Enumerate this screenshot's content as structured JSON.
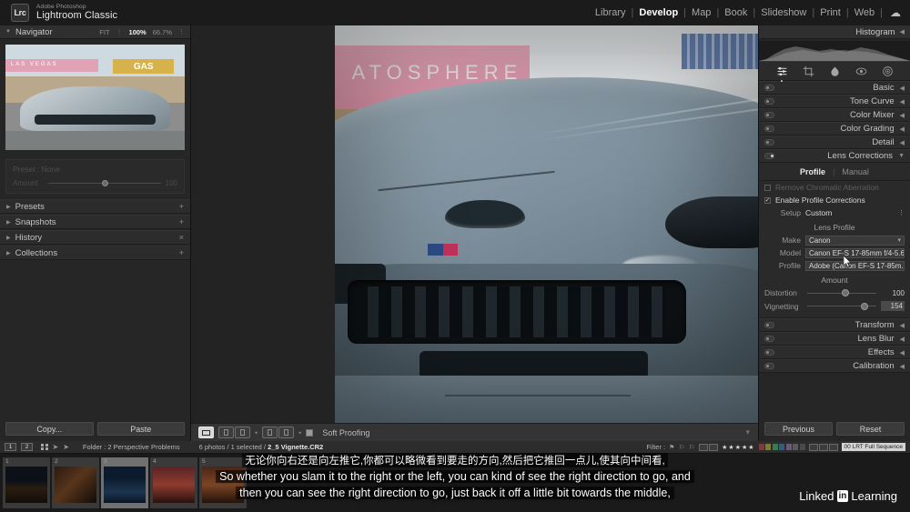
{
  "app": {
    "badge": "Lrc",
    "brand_sup": "Adobe Photoshop",
    "brand_main": "Lightroom Classic"
  },
  "modules": {
    "items": [
      {
        "label": "Library",
        "active": false
      },
      {
        "label": "Develop",
        "active": true
      },
      {
        "label": "Map",
        "active": false
      },
      {
        "label": "Book",
        "active": false
      },
      {
        "label": "Slideshow",
        "active": false
      },
      {
        "label": "Print",
        "active": false
      },
      {
        "label": "Web",
        "active": false
      }
    ],
    "separator": "|",
    "cloud_icon": "cloud-icon"
  },
  "left_panel": {
    "navigator": {
      "title": "Navigator",
      "zoom_fit": "FIT",
      "zoom_100": "100%",
      "zoom_667": "66.7%"
    },
    "preset_strip": {
      "preset_label": "Preset : None",
      "amount_label": "Amount",
      "amount_value": "100"
    },
    "sections": [
      {
        "label": "Presets",
        "adorn": "+"
      },
      {
        "label": "Snapshots",
        "adorn": "+"
      },
      {
        "label": "History",
        "adorn": "×"
      },
      {
        "label": "Collections",
        "adorn": "+"
      }
    ],
    "copy_label": "Copy...",
    "paste_label": "Paste"
  },
  "photo": {
    "wall_text": "ATOSPHERE"
  },
  "center_toolbar": {
    "soft_proofing_label": "Soft Proofing",
    "dot": "•"
  },
  "right_panel": {
    "histogram_title": "Histogram",
    "tools": [
      "basic-adjust-icon",
      "crop-icon",
      "heal-icon",
      "masking-icon",
      "radial-icon"
    ],
    "sections": [
      {
        "label": "Basic",
        "expanded": false
      },
      {
        "label": "Tone Curve",
        "expanded": false
      },
      {
        "label": "Color Mixer",
        "expanded": false
      },
      {
        "label": "Color Grading",
        "expanded": false
      },
      {
        "label": "Detail",
        "expanded": false
      },
      {
        "label": "Lens Corrections",
        "expanded": true
      }
    ],
    "lens_corrections": {
      "tab_profile": "Profile",
      "tab_manual": "Manual",
      "remove_ca_label": "Remove Chromatic Aberration",
      "remove_ca_checked": false,
      "enable_profile_label": "Enable Profile Corrections",
      "enable_profile_checked": true,
      "check_glyph": "✓",
      "setup_key": "Setup",
      "setup_value": "Custom",
      "lens_profile_label": "Lens Profile",
      "make_key": "Make",
      "make_value": "Canon",
      "model_key": "Model",
      "model_value": "Canon EF-S 17-85mm f/4-5.6...",
      "profile_key": "Profile",
      "profile_value": "Adobe (Canon EF-S 17-85m...",
      "amount_label": "Amount",
      "distortion_key": "Distortion",
      "distortion_value": "100",
      "vignetting_key": "Vignetting",
      "vignetting_value": "154"
    },
    "sections_lower": [
      {
        "label": "Transform"
      },
      {
        "label": "Lens Blur"
      },
      {
        "label": "Effects"
      },
      {
        "label": "Calibration"
      }
    ],
    "previous_label": "Previous",
    "reset_label": "Reset"
  },
  "filmstrip": {
    "page_left": "1",
    "page_right": "2",
    "folder_label": "Folder : 2 Perspective Problems",
    "photo_count": "6 photos / 1 selected / ",
    "selected_file": "2_5 Vignette.CR2",
    "filter_label": "Filter :",
    "stars": "★★★★★",
    "sequence_label": "00 LRT Full Sequence",
    "color_swatches": [
      "#7a3b3b",
      "#7a7a3b",
      "#3b7a4a",
      "#3b5a7a",
      "#6a5a7a",
      "#5a5a5a",
      "#4a4a4a"
    ],
    "thumbnails": [
      {
        "number": "1",
        "name": "night-cityscape"
      },
      {
        "number": "2",
        "name": "night-street"
      },
      {
        "number": "3",
        "name": "big-ben-tower"
      },
      {
        "number": "4",
        "name": "red-interior"
      },
      {
        "number": "5",
        "name": "warm-interior"
      }
    ]
  },
  "subtitles": {
    "chinese": "无论你向右还是向左推它,你都可以略微看到要走的方向,然后把它推回一点儿,使其向中间看,",
    "english_line1": "So whether you slam it to the right or the left, you can kind of see the right direction to go, and",
    "english_line2": "then you can see the right direction to go, just back it off a little bit towards the middle,"
  },
  "watermark": {
    "linked": "Linked",
    "in": "in",
    "learning": "Learning"
  }
}
